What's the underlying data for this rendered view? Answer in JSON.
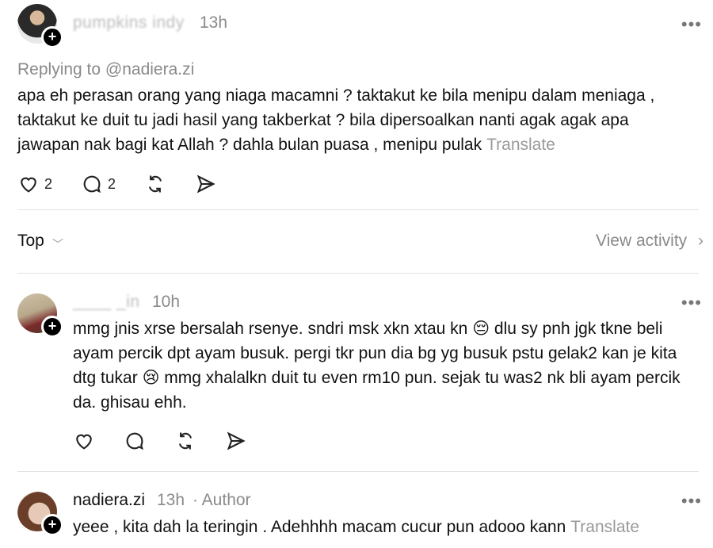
{
  "post1": {
    "username": "pumpkins indy",
    "time": "13h",
    "more": "•••",
    "replying": "Replying to @nadiera.zi",
    "text": "apa eh perasan orang yang niaga macamni ? taktakut ke bila menipu dalam meniaga , taktakut ke duit tu jadi hasil yang takberkat ? bila dipersoalkan nanti agak agak apa jawapan nak bagi kat Allah ? dahla bulan puasa , menipu pulak",
    "translate": "Translate",
    "likes": "2",
    "replies": "2"
  },
  "filter": {
    "top_label": "Top",
    "view_activity": "View activity"
  },
  "post2": {
    "username": "____ _in",
    "time": "10h",
    "more": "•••",
    "text_a": "mmg jnis xrse bersalah rsenye. sndri msk xkn xtau kn ",
    "emoji_a": "😔",
    "text_b": " dlu sy pnh jgk tkne beli ayam percik dpt ayam busuk. pergi tkr pun dia bg yg busuk pstu gelak2 kan je kita dtg tukar ",
    "emoji_b": "😢",
    "text_c": " mmg xhalalkn duit tu even rm10 pun. sejak tu was2 nk bli ayam percik da. ghisau ehh."
  },
  "post3": {
    "username": "nadiera.zi",
    "time": "13h",
    "author_tag": "· Author",
    "more": "•••",
    "text": "yeee , kita dah la teringin . Adehhhh macam cucur pun adooo kann",
    "translate": "Translate"
  },
  "icons": {
    "like": "heart-icon",
    "reply": "comment-icon",
    "repost": "repost-icon",
    "share": "share-icon",
    "follow": "plus-icon",
    "chevron": "chevron-down-icon",
    "arrow": "chevron-right-icon"
  }
}
